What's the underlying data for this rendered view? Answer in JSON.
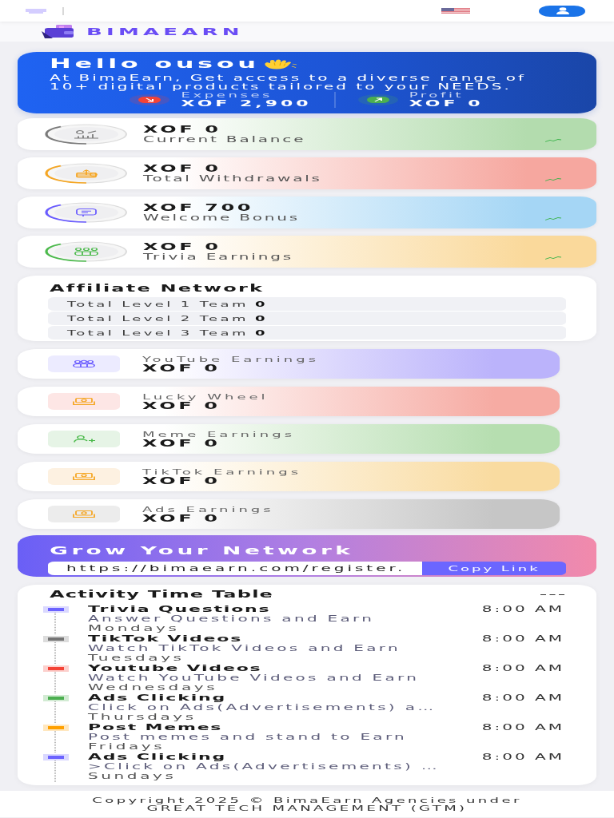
{
  "brand": {
    "name": "BIMAEARN"
  },
  "greeting": {
    "title": "Hello ousou",
    "text": "At BimaEarn, Get access to a diverse range of 10+ digital products tailored to your NEEDS.",
    "stats": [
      {
        "kind": "expenses",
        "label": "Expenses",
        "value": "XOF 2,900"
      },
      {
        "kind": "profit",
        "label": "Profit",
        "value": "XOF 0"
      }
    ]
  },
  "balances": [
    {
      "kind": "balance",
      "value": "XOF 0",
      "label": "Current Balance"
    },
    {
      "kind": "withdrawals",
      "value": "XOF 0",
      "label": "Total Withdrawals"
    },
    {
      "kind": "bonus",
      "value": "XOF 700",
      "label": "Welcome Bonus"
    },
    {
      "kind": "trivia",
      "value": "XOF 0",
      "label": "Trivia Earnings"
    }
  ],
  "affiliate": {
    "title": "Affiliate Network",
    "rows": [
      {
        "label": "Total Level 1 Team",
        "value": "0"
      },
      {
        "label": "Total Level 2 Team",
        "value": "0"
      },
      {
        "label": "Total Level 3 Team",
        "value": "0"
      }
    ]
  },
  "earnings": [
    {
      "kind": "youtube",
      "label": "YouTube Earnings",
      "value": "XOF 0"
    },
    {
      "kind": "wheel",
      "label": "Lucky Wheel",
      "value": "XOF 0"
    },
    {
      "kind": "meme",
      "label": "Meme Earnings",
      "value": "XOF 0"
    },
    {
      "kind": "tiktok",
      "label": "TikTok Earnings",
      "value": "XOF 0"
    },
    {
      "kind": "ads",
      "label": "Ads Earnings",
      "value": "XOF 0"
    }
  ],
  "invite": {
    "title": "Grow Your Network",
    "link": "https://bimaearn.com/register.",
    "button": "Copy Link"
  },
  "timetable": {
    "title": "Activity Time Table",
    "items": [
      {
        "title": "Trivia Questions",
        "text": "Answer Questions and Earn",
        "day": "Mondays",
        "time": "8:00 AM",
        "color": "#6c63ff"
      },
      {
        "title": "TikTok Videos",
        "text": "Watch TikTok Videos and Earn",
        "day": "Tuesdays",
        "time": "8:00 AM",
        "color": "#757575"
      },
      {
        "title": "Youtube Videos",
        "text": "Watch YouTube Videos and Earn",
        "day": "Wednesdays",
        "time": "8:00 AM",
        "color": "#f44336"
      },
      {
        "title": "Ads Clicking",
        "text": "Click on Ads(Advertisements) a…",
        "day": "Thursdays",
        "time": "8:00 AM",
        "color": "#4caf50"
      },
      {
        "title": "Post Memes",
        "text": "Post memes and stand to Earn",
        "day": "Fridays",
        "time": "8:00 AM",
        "color": "#ffa000"
      },
      {
        "title": "Ads Clicking",
        "text": ">Click on Ads(Advertisements) …",
        "day": "Sundays",
        "time": "8:00 AM",
        "color": "#6c63ff"
      }
    ]
  },
  "footer": {
    "text": "Copyright 2025 © BimaEarn Agencies under GREAT TECH MANAGEMENT (GTM)"
  }
}
